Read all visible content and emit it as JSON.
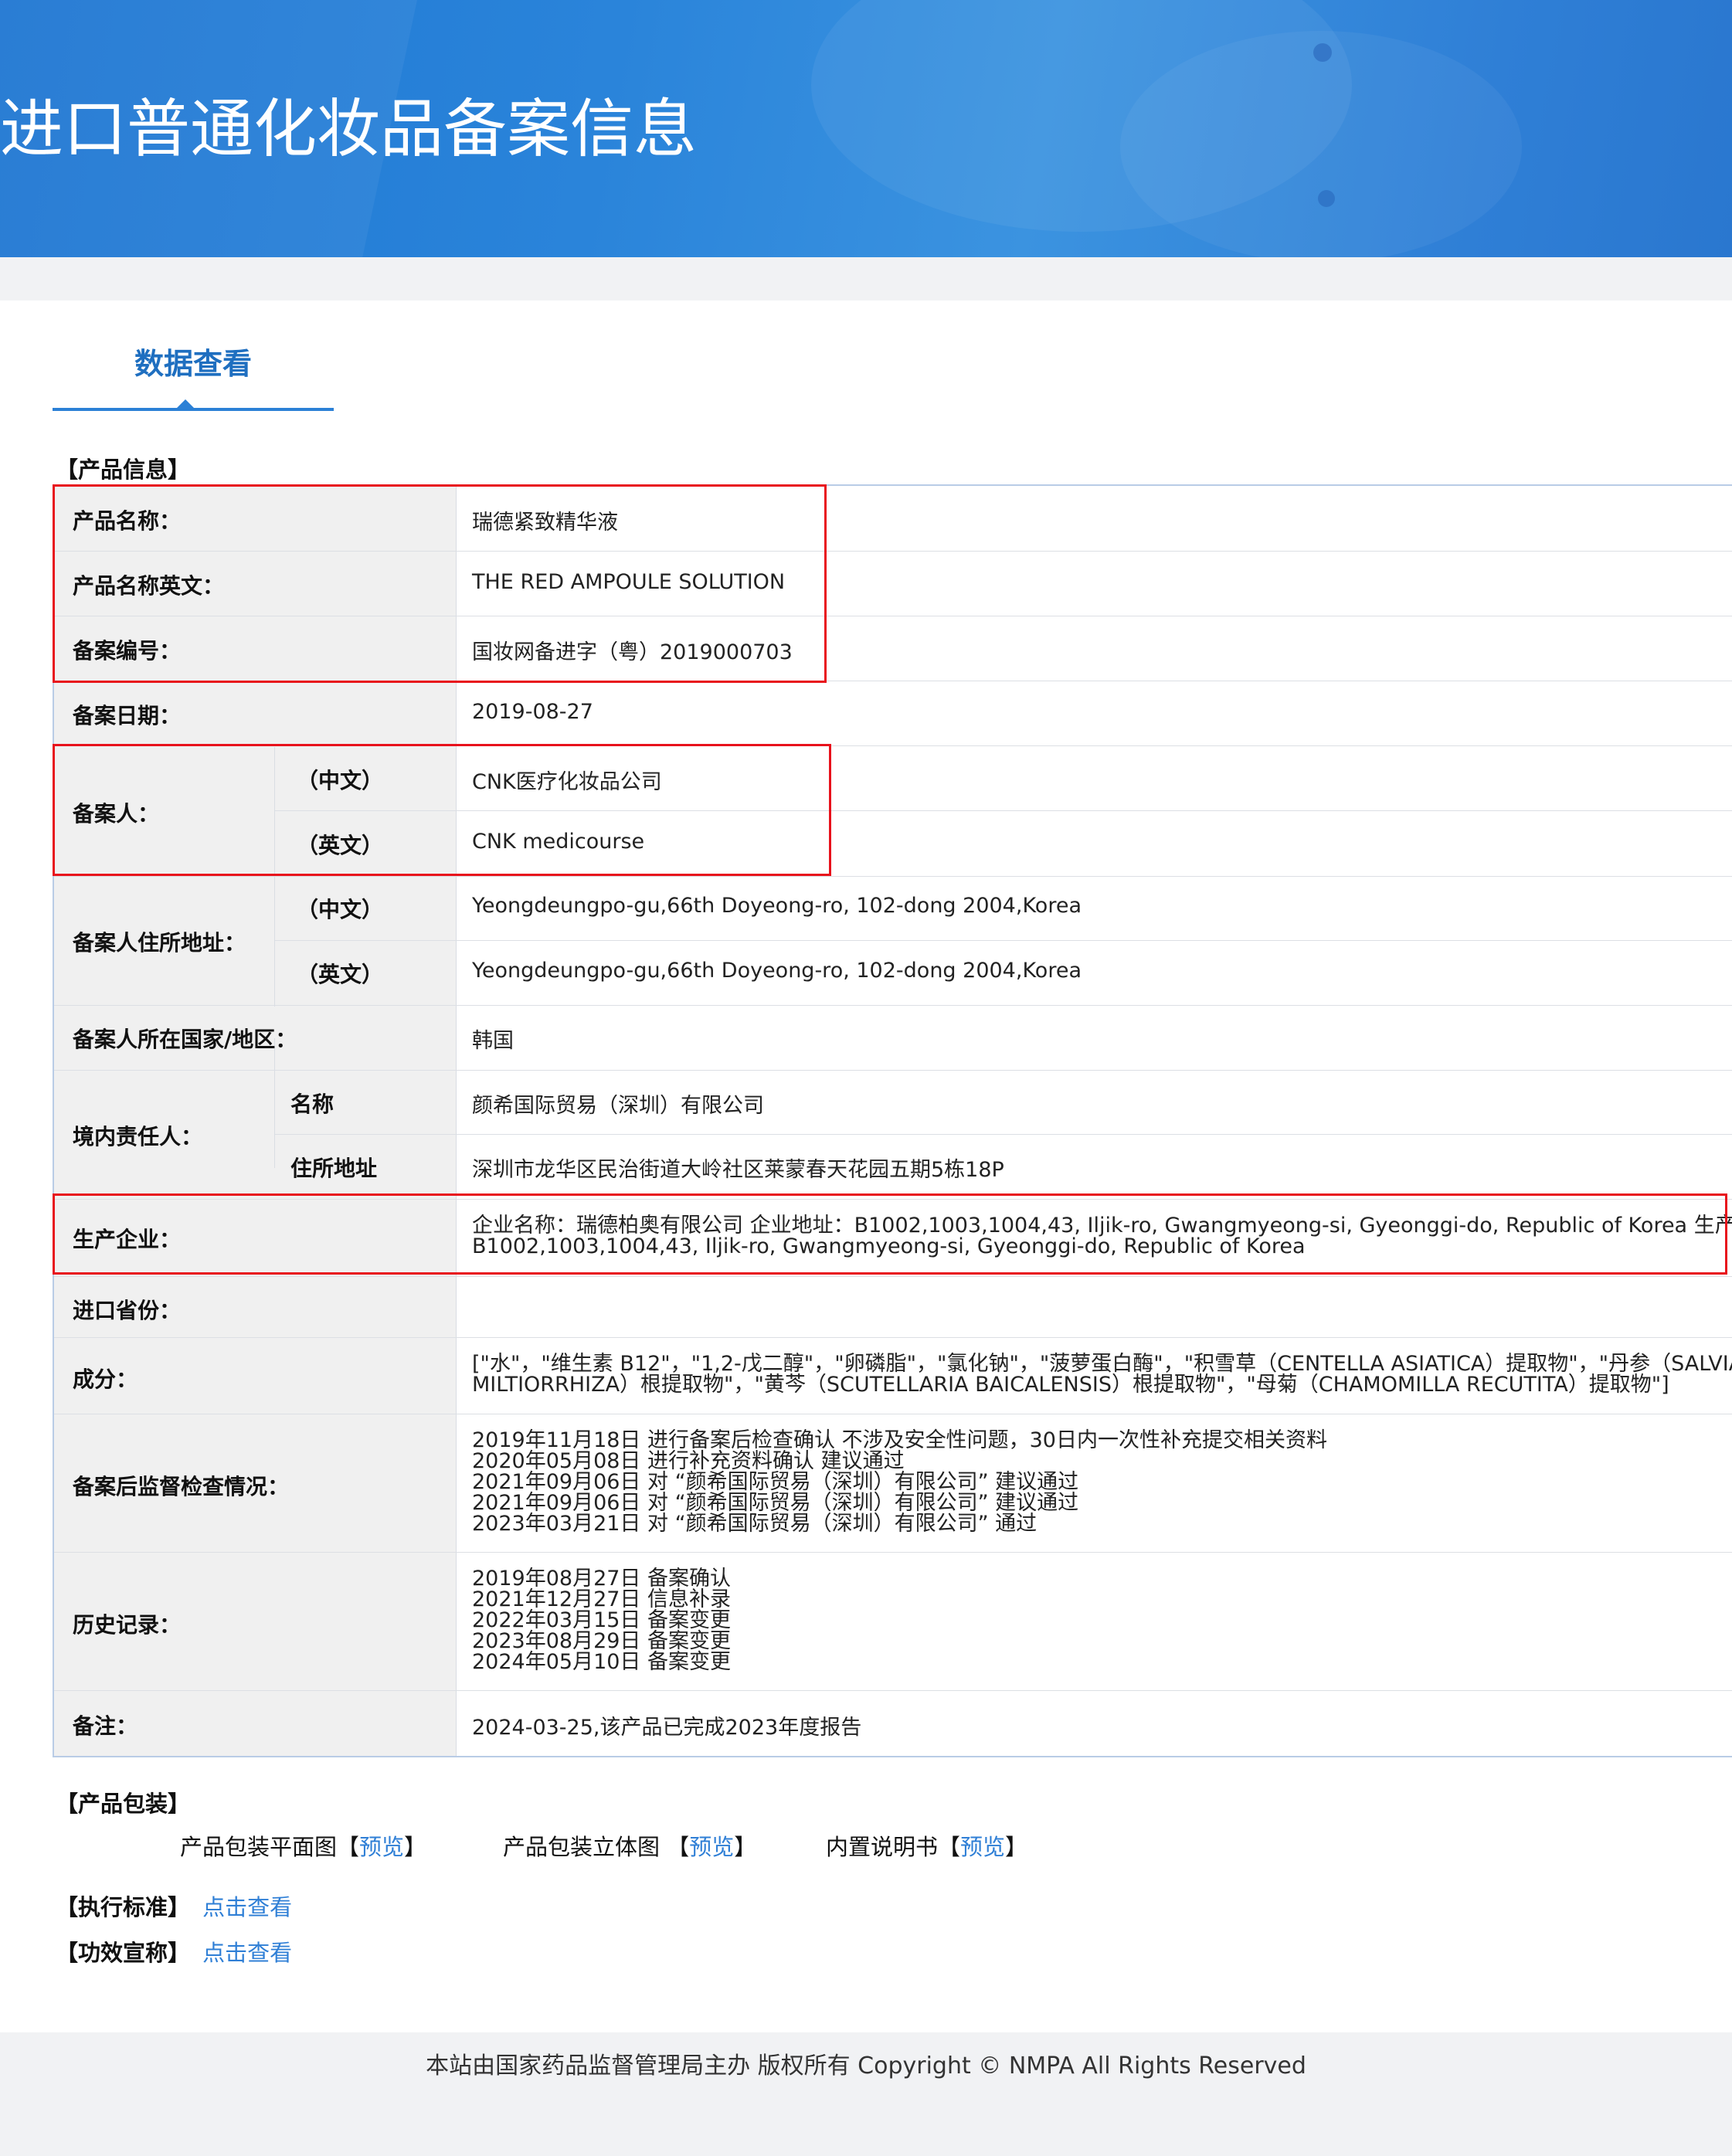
{
  "banner": {
    "title": "进口普通化妆品备案信息"
  },
  "tab": {
    "label": "数据查看"
  },
  "sections": {
    "product_info": "【产品信息】",
    "packaging": "【产品包装】",
    "standard": "【执行标准】",
    "claims": "【功效宣称】"
  },
  "product": {
    "name": {
      "label": "产品名称：",
      "value": "瑞德紧致精华液"
    },
    "name_en": {
      "label": "产品名称英文：",
      "value": "THE RED AMPOULE SOLUTION"
    },
    "record_no": {
      "label": "备案编号：",
      "value": "国妆网备进字（粤）2019000703"
    },
    "record_date": {
      "label": "备案日期：",
      "value": "2019-08-27"
    },
    "applicant": {
      "label": "备案人：",
      "cn_label": "（中文）",
      "cn": "CNK医疗化妆品公司",
      "en_label": "（英文）",
      "en": "CNK medicourse"
    },
    "applicant_address": {
      "label": "备案人住所地址：",
      "cn_label": "（中文）",
      "cn": "Yeongdeungpo-gu,66th Doyeong-ro, 102-dong 2004,Korea",
      "en_label": "（英文）",
      "en": "Yeongdeungpo-gu,66th Doyeong-ro, 102-dong 2004,Korea"
    },
    "country": {
      "label": "备案人所在国家/地区：",
      "value": "韩国"
    },
    "domestic": {
      "label": "境内责任人：",
      "name_label": "名称",
      "name": "颜希国际贸易（深圳）有限公司",
      "addr_label": "住所地址",
      "addr": "深圳市龙华区民治街道大岭社区莱蒙春天花园五期5栋18P"
    },
    "manufacturer": {
      "label": "生产企业：",
      "line1": "企业名称：瑞德柏奥有限公司 企业地址：B1002,1003,1004,43, Iljik-ro, Gwangmyeong-si, Gyeonggi-do, Republic of Korea 生产地址：",
      "line2": "B1002,1003,1004,43, Iljik-ro, Gwangmyeong-si, Gyeonggi-do, Republic of Korea"
    },
    "import_province": {
      "label": "进口省份：",
      "value": ""
    },
    "ingredients": {
      "label": "成分：",
      "line1": "[\"水\"，\"维生素 B12\"，\"1,2-戊二醇\"，\"卵磷脂\"，\"氯化钠\"，\"菠萝蛋白酶\"，\"积雪草（CENTELLA ASIATICA）提取物\"，\"丹参（SALVIA",
      "line2": "MILTIORRHIZA）根提取物\"，\"黄芩（SCUTELLARIA BAICALENSIS）根提取物\"，\"母菊（CHAMOMILLA RECUTITA）提取物\"]"
    },
    "supervision": {
      "label": "备案后监督检查情况：",
      "lines": [
        "2019年11月18日 进行备案后检查确认 不涉及安全性问题，30日内一次性补充提交相关资料",
        "2020年05月08日 进行补充资料确认 建议通过",
        "2021年09月06日 对 “颜希国际贸易（深圳）有限公司” 建议通过",
        "2021年09月06日 对 “颜希国际贸易（深圳）有限公司” 建议通过",
        "2023年03月21日 对 “颜希国际贸易（深圳）有限公司” 通过"
      ]
    },
    "history": {
      "label": "历史记录：",
      "lines": [
        "2019年08月27日 备案确认",
        "2021年12月27日 信息补录",
        "2022年03月15日 备案变更",
        "2023年08月29日 备案变更",
        "2024年05月10日 备案变更"
      ]
    },
    "remark": {
      "label": "备注：",
      "value": "2024-03-25,该产品已完成2023年度报告"
    }
  },
  "packaging": {
    "flat": {
      "label": "产品包装平面图【",
      "link": "预览",
      "end": "】"
    },
    "solid": {
      "label": "产品包装立体图 【",
      "link": "预览",
      "end": "】"
    },
    "manual": {
      "label": "内置说明书【",
      "link": "预览",
      "end": "】"
    }
  },
  "links": {
    "standard": "点击查看",
    "claims": "点击查看"
  },
  "footer": {
    "text": "本站由国家药品监督管理局主办 版权所有 Copyright © NMPA All Rights Reserved"
  },
  "colors": {
    "banner": "#2a84da",
    "accent": "#2b80d6",
    "link": "#2f7fd6",
    "highlight": "#e8121c"
  }
}
